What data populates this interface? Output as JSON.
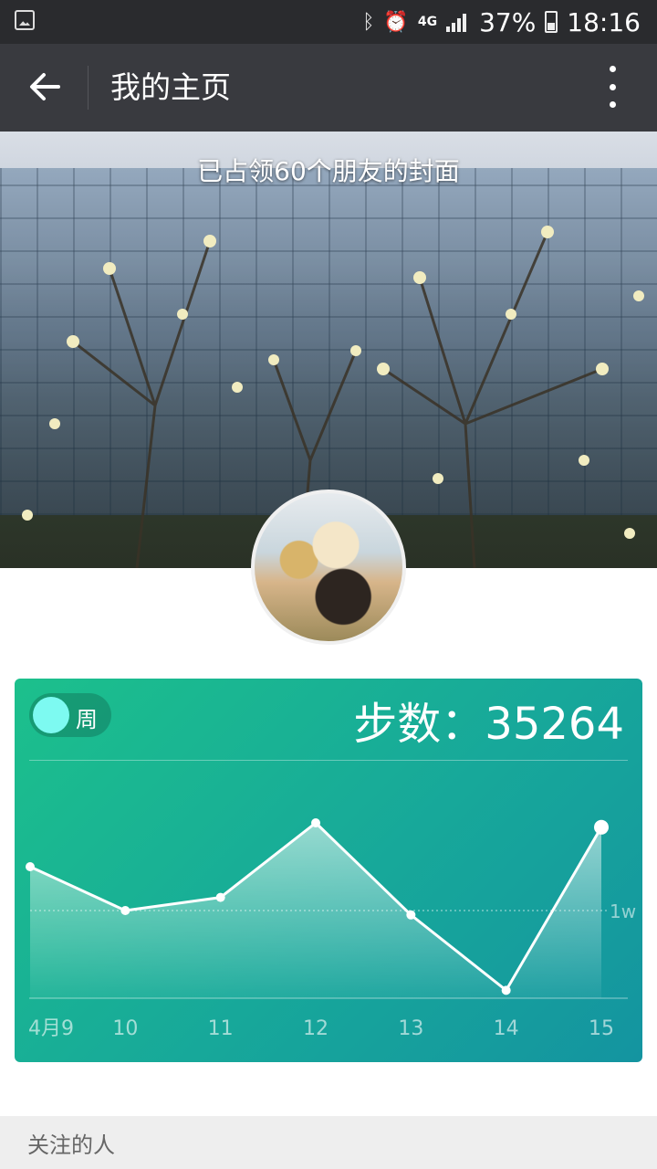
{
  "status_bar": {
    "icons": [
      "image-notification-icon",
      "bluetooth-icon",
      "alarm-icon",
      "network-4g-icon",
      "signal-icon",
      "battery-icon"
    ],
    "network": "4G",
    "battery": "37%",
    "time": "18:16"
  },
  "app_bar": {
    "title": "我的主页",
    "back_icon": "arrow-left-icon",
    "more_icon": "more-vertical-icon"
  },
  "cover": {
    "caption": "已占领60个朋友的封面"
  },
  "step_card": {
    "toggle_label": "周",
    "steps_label": "步数：35264",
    "colors": {
      "gradient_start": "#1cc08c",
      "gradient_end": "#1494a0",
      "toggle_knob": "#7dfaf1"
    }
  },
  "chart_data": {
    "type": "line",
    "categories": [
      "4月9",
      "10",
      "11",
      "12",
      "13",
      "14",
      "15"
    ],
    "values": [
      15000,
      10000,
      11500,
      20000,
      9500,
      900,
      19500
    ],
    "ylim": [
      0,
      25000
    ],
    "reference_line": {
      "value": 10000,
      "label": "1w"
    },
    "grid": false
  },
  "following": {
    "label": "关注的人"
  }
}
